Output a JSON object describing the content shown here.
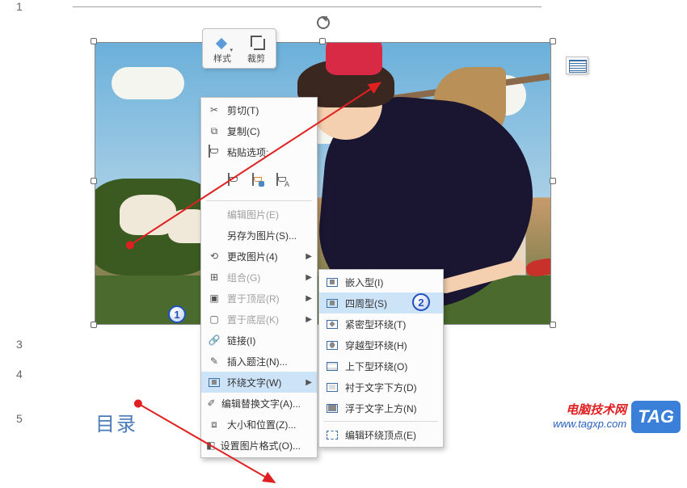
{
  "lineNumbers": [
    "1",
    "3",
    "4",
    "5"
  ],
  "tocLabel": "目录",
  "miniToolbar": {
    "style": "样式",
    "crop": "裁剪"
  },
  "mainMenu": {
    "cut": "剪切(T)",
    "copy": "复制(C)",
    "pasteOptions": "粘贴选项:",
    "editPicture": "编辑图片(E)",
    "saveAsPicture": "另存为图片(S)...",
    "changePicture": "更改图片(4)",
    "group": "组合(G)",
    "bringToFront": "置于顶层(R)",
    "sendToBack": "置于底层(K)",
    "link": "链接(I)",
    "insertCaption": "插入题注(N)...",
    "wrapText": "环绕文字(W)",
    "editAltText": "编辑替换文字(A)...",
    "sizePosition": "大小和位置(Z)...",
    "formatPicture": "设置图片格式(O)..."
  },
  "subMenu": {
    "inline": "嵌入型(I)",
    "square": "四周型(S)",
    "tight": "紧密型环绕(T)",
    "through": "穿越型环绕(H)",
    "topBottom": "上下型环绕(O)",
    "behindText": "衬于文字下方(D)",
    "inFrontOfText": "浮于文字上方(N)",
    "editWrapPoints": "编辑环绕顶点(E)"
  },
  "badges": {
    "one": "1",
    "two": "2"
  },
  "watermark": {
    "title": "电脑技术网",
    "url": "www.tagxp.com",
    "tag": "TAG"
  }
}
